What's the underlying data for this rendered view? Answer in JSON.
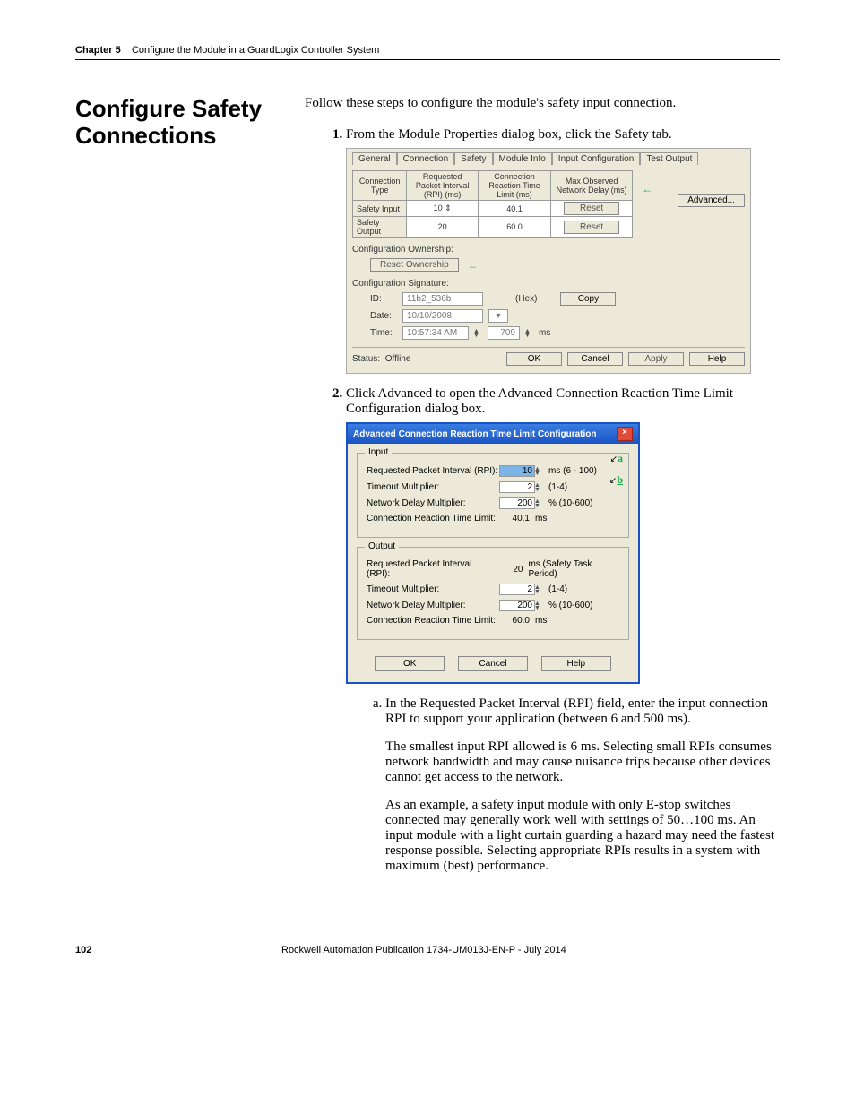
{
  "header": {
    "chapter_label": "Chapter 5",
    "chapter_title": "Configure the Module in a GuardLogix Controller System"
  },
  "section_title": "Configure Safety Connections",
  "intro": "Follow these steps to configure the module's safety input connection.",
  "steps": {
    "s1": "From the Module Properties dialog box, click the Safety tab.",
    "s2": "Click Advanced to open the Advanced Connection Reaction Time Limit Configuration dialog box."
  },
  "dlg1": {
    "tabs": [
      "General",
      "Connection",
      "Safety",
      "Module Info",
      "Input Configuration",
      "Test Output"
    ],
    "col_headers": [
      "Connection Type",
      "Requested Packet Interval (RPI) (ms)",
      "Connection Reaction Time Limit (ms)",
      "Max Observed Network Delay (ms)"
    ],
    "rows": [
      {
        "type": "Safety Input",
        "rpi": "10",
        "crtl": "40.1",
        "reset": "Reset"
      },
      {
        "type": "Safety Output",
        "rpi": "20",
        "crtl": "60.0",
        "reset": "Reset"
      }
    ],
    "advanced_btn": "Advanced...",
    "config_ownership_label": "Configuration Ownership:",
    "reset_ownership_btn": "Reset Ownership",
    "config_signature_label": "Configuration Signature:",
    "id_label": "ID:",
    "id_value": "11b2_536b",
    "hex_label": "(Hex)",
    "copy_btn": "Copy",
    "date_label": "Date:",
    "date_value": "10/10/2008",
    "time_label": "Time:",
    "time_value": "10:57:34 AM",
    "time_ms": "709",
    "ms_label": "ms",
    "status_label": "Status:",
    "status_value": "Offline",
    "ok_btn": "OK",
    "cancel_btn": "Cancel",
    "apply_btn": "Apply",
    "help_btn": "Help"
  },
  "dlg2": {
    "title": "Advanced Connection Reaction Time Limit Configuration",
    "input_group": "Input",
    "output_group": "Output",
    "rpi_label": "Requested Packet Interval (RPI):",
    "tm_label": "Timeout Multiplier:",
    "ndm_label": "Network Delay Multiplier:",
    "crtl_label": "Connection Reaction Time Limit:",
    "input_rpi": "10",
    "input_rpi_range": "ms (6 - 100)",
    "input_tm": "2",
    "input_tm_range": "(1-4)",
    "input_ndm": "200",
    "input_ndm_range": "% (10-600)",
    "input_crtl": "40.1",
    "output_rpi": "20",
    "output_rpi_range": "ms (Safety Task Period)",
    "output_tm": "2",
    "output_tm_range": "(1-4)",
    "output_ndm": "200",
    "output_ndm_range": "% (10-600)",
    "output_crtl": "60.0",
    "ms": "ms",
    "ok": "OK",
    "cancel": "Cancel",
    "help": "Help",
    "letter_a": "a",
    "letter_b": "b"
  },
  "substeps": {
    "a1": "In the Requested Packet Interval (RPI) field, enter the input connection RPI to support your application (between 6 and 500 ms).",
    "a2": "The smallest input RPI allowed is 6 ms. Selecting small RPIs consumes network bandwidth and may cause nuisance trips because other devices cannot get access to the network.",
    "a3": "As an example, a safety input module with only E-stop switches connected may generally work well with settings of 50…100 ms. An input module with a light curtain guarding a hazard may need the fastest response possible. Selecting appropriate RPIs results in a system with maximum (best) performance."
  },
  "footer": {
    "page": "102",
    "pub": "Rockwell Automation Publication 1734-UM013J-EN-P - July 2014"
  }
}
